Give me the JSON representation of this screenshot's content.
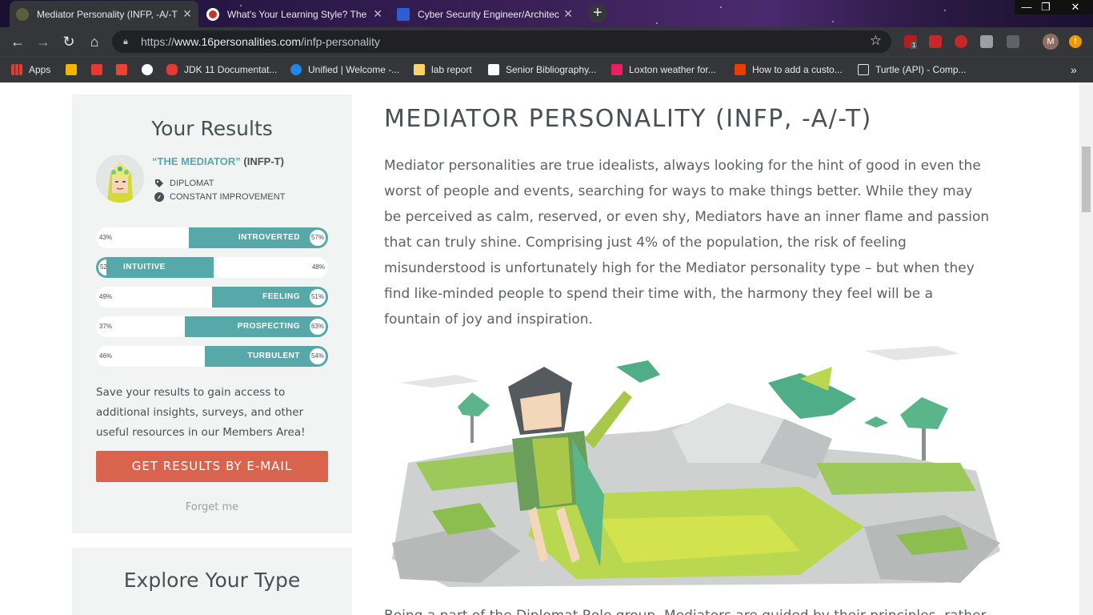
{
  "browser": {
    "tabs": [
      {
        "title": "Mediator Personality (INFP, -A/-T",
        "active": true
      },
      {
        "title": "What's Your Learning Style? The",
        "active": false
      },
      {
        "title": "Cyber Security Engineer/Architec",
        "active": false
      }
    ],
    "new_tab": "+",
    "window_controls": {
      "minimize": "—",
      "restore": "❐",
      "close": "✕"
    },
    "url_prefix": "https://",
    "url_host": "www.16personalities.com",
    "url_path": "/infp-personality",
    "extension_badge": "1",
    "profile_initial": "M",
    "update_indicator": "!",
    "bookmarks": [
      {
        "label": "Apps",
        "icon": "apps-grid-icon"
      },
      {
        "label": "JDK 11 Documentat...",
        "icon": "oracle-icon"
      },
      {
        "label": "Unified | Welcome -...",
        "icon": "unified-icon"
      },
      {
        "label": "lab report",
        "icon": "folder-icon"
      },
      {
        "label": "Senior Bibliography...",
        "icon": "bibliography-icon"
      },
      {
        "label": "Loxton weather for...",
        "icon": "weather-icon"
      },
      {
        "label": "How to add a custo...",
        "icon": "office-icon"
      },
      {
        "label": "Turtle (API) - Comp...",
        "icon": "document-icon"
      }
    ],
    "more_bookmarks": "»"
  },
  "sidebar": {
    "results_title": "Your Results",
    "nickname": "“THE MEDIATOR”",
    "type_code": "(INFP-T)",
    "role": "DIPLOMAT",
    "strategy": "CONSTANT IMPROVEMENT",
    "traits": [
      {
        "label": "INTROVERTED",
        "left_pct": "43%",
        "right_pct": "57%",
        "side": "right",
        "fill": 0.57
      },
      {
        "label": "INTUITIVE",
        "left_pct": "52%",
        "right_pct": "48%",
        "side": "left",
        "fill": 0.52
      },
      {
        "label": "FEELING",
        "left_pct": "49%",
        "right_pct": "51%",
        "side": "right",
        "fill": 0.51
      },
      {
        "label": "PROSPECTING",
        "left_pct": "37%",
        "right_pct": "63%",
        "side": "right",
        "fill": 0.63
      },
      {
        "label": "TURBULENT",
        "left_pct": "46%",
        "right_pct": "54%",
        "side": "right",
        "fill": 0.54
      }
    ],
    "save_text": "Save your results to gain access to additional insights, surveys, and other useful resources in our Members Area!",
    "email_button": "GET RESULTS BY E-MAIL",
    "forget_link": "Forget me",
    "explore_title": "Explore Your Type"
  },
  "main": {
    "title": "MEDIATOR PERSONALITY (INFP, -A/-T)",
    "intro": "Mediator personalities are true idealists, always looking for the hint of good in even the worst of people and events, searching for ways to make things better. While they may be perceived as calm, reserved, or even shy, Mediators have an inner flame and passion that can truly shine. Comprising just 4% of the population, the risk of feeling misunderstood is unfortunately high for the Mediator personality type – but when they find like-minded people to spend their time with, the harmony they feel will be a fountain of joy and inspiration.",
    "next_paragraph": "Being a part of the Diplomat Role group, Mediators are guided by their principles, rather"
  },
  "colors": {
    "teal": "#56a9a8",
    "button": "#d9634d",
    "card": "#f2f3f3",
    "text": "#4a4f54"
  }
}
